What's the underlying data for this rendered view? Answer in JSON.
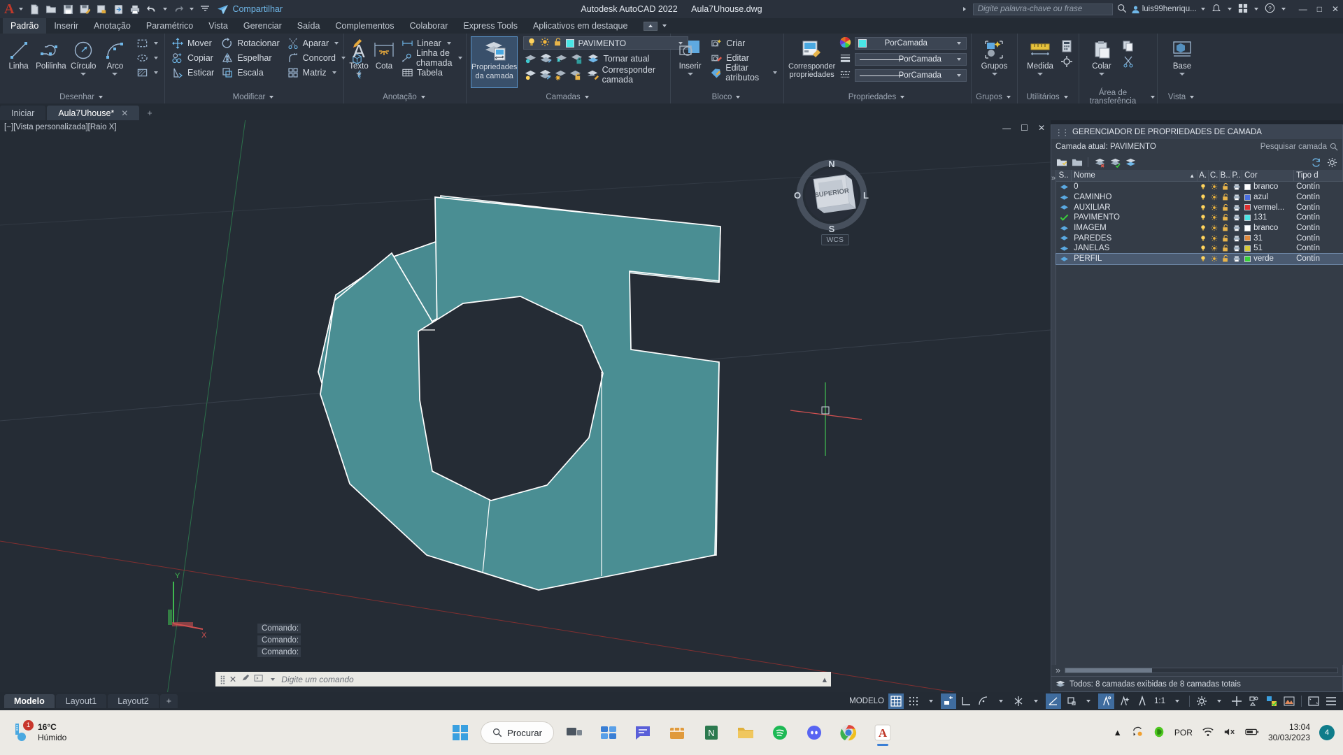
{
  "titlebar": {
    "app_menu": "A",
    "quick_access": [
      "new-icon",
      "open-icon",
      "save-icon",
      "save-as-icon",
      "plot-preview-icon",
      "sync-icon",
      "print-icon",
      "undo-icon",
      "redo-icon",
      "customize-icon"
    ],
    "share_label": "Compartilhar",
    "app_title": "Autodesk AutoCAD 2022",
    "file_name": "Aula7Uhouse.dwg",
    "search_placeholder": "Digite palavra-chave ou frase",
    "user_name": "luis99henriqu...",
    "window_buttons": [
      "minimize",
      "restore",
      "close"
    ]
  },
  "menu": {
    "tabs": [
      "Padrão",
      "Inserir",
      "Anotação",
      "Paramétrico",
      "Vista",
      "Gerenciar",
      "Saída",
      "Complementos",
      "Colaborar",
      "Express Tools",
      "Aplicativos em destaque"
    ],
    "active": "Padrão"
  },
  "ribbon": {
    "panels": [
      {
        "title": "Desenhar",
        "big": [
          {
            "label": "Linha",
            "icon": "line-icon"
          },
          {
            "label": "Polilinha",
            "icon": "polyline-icon"
          },
          {
            "label": "Círculo",
            "icon": "circle-icon",
            "has_dropdown": true
          },
          {
            "label": "Arco",
            "icon": "arc-icon",
            "has_dropdown": true
          }
        ],
        "small_icons": [
          "rectangle-icon",
          "ellipse-icon",
          "hatch-icon"
        ]
      },
      {
        "title": "Modificar",
        "items": [
          {
            "label": "Mover",
            "icon": "move-icon"
          },
          {
            "label": "Rotacionar",
            "icon": "rotate-icon"
          },
          {
            "label": "Aparar",
            "icon": "trim-icon",
            "has_dropdown": true
          },
          {
            "label": "Copiar",
            "icon": "copy-icon"
          },
          {
            "label": "Espelhar",
            "icon": "mirror-icon"
          },
          {
            "label": "Concord",
            "icon": "fillet-icon",
            "has_dropdown": true
          },
          {
            "label": "Esticar",
            "icon": "stretch-icon"
          },
          {
            "label": "Escala",
            "icon": "scale-icon"
          },
          {
            "label": "Matriz",
            "icon": "array-icon",
            "has_dropdown": true
          }
        ],
        "extra_icons": [
          "pencil-icon",
          "3dsolid-icon",
          "offset-icon"
        ]
      },
      {
        "title": "Anotação",
        "big": [
          {
            "label": "Texto",
            "icon": "text-icon",
            "has_dropdown": true
          },
          {
            "label": "Cota",
            "icon": "dimension-icon"
          }
        ],
        "items": [
          {
            "label": "Linear",
            "icon": "linear-dim-icon",
            "has_dropdown": true
          },
          {
            "label": "Linha de chamada",
            "icon": "leader-icon",
            "has_dropdown": true
          },
          {
            "label": "Tabela",
            "icon": "table-icon"
          }
        ]
      },
      {
        "title": "Camadas",
        "big": [
          {
            "label": "Propriedades da camada",
            "icon": "layer-properties-icon",
            "active": true
          }
        ],
        "current_layer": "PAVIMENTO",
        "current_layer_color": "#49e5e5",
        "items": [
          {
            "label": "Tornar atual",
            "icon": "make-current-icon"
          },
          {
            "label": "Corresponder camada",
            "icon": "match-layer-icon"
          }
        ],
        "toggle_icons": [
          "layer-off-icon",
          "layer-isolate-icon",
          "layer-freeze-icon",
          "layer-lock-icon",
          "layer-on-icon",
          "layer-unisolate-icon",
          "layer-thaw-icon",
          "layer-unlock-icon"
        ]
      },
      {
        "title": "Bloco",
        "big": [
          {
            "label": "Inserir",
            "icon": "insert-block-icon",
            "has_dropdown": true
          }
        ],
        "items": [
          {
            "label": "Criar",
            "icon": "create-block-icon"
          },
          {
            "label": "Editar",
            "icon": "edit-block-icon"
          },
          {
            "label": "Editar atributos",
            "icon": "edit-attributes-icon",
            "has_dropdown": true
          }
        ]
      },
      {
        "title": "Propriedades",
        "big": [
          {
            "label": "Corresponder propriedades",
            "icon": "match-properties-icon"
          }
        ],
        "combos": [
          {
            "icon": "color-wheel-icon",
            "value": "PorCamada",
            "swatch": "#49e5e5"
          },
          {
            "icon": "linewidth-icon",
            "value": "PorCamada"
          },
          {
            "icon": "linetype-icon",
            "value": "PorCamada"
          }
        ]
      },
      {
        "title": "Grupos",
        "big": [
          {
            "label": "Grupo",
            "icon": "group-icon",
            "has_dropdown": true
          }
        ]
      },
      {
        "title": "Utilitários",
        "big": [
          {
            "label": "Medida",
            "icon": "measure-icon",
            "has_dropdown": true
          }
        ]
      },
      {
        "title": "Área de transferência",
        "big": [
          {
            "label": "Colar",
            "icon": "paste-icon",
            "has_dropdown": true
          }
        ]
      },
      {
        "title": "Vista",
        "big": [
          {
            "label": "Base",
            "icon": "base-view-icon",
            "has_dropdown": true
          }
        ]
      }
    ]
  },
  "doc_tabs": {
    "tabs": [
      {
        "label": "Iniciar",
        "active": false,
        "closable": false
      },
      {
        "label": "Aula7Uhouse*",
        "active": true,
        "closable": true
      }
    ],
    "add_label": "+"
  },
  "canvas": {
    "viewport_label": "[−][Vista personalizada][Raio X]",
    "viewcube": {
      "top": "SUPERIOR",
      "n": "N",
      "s": "S",
      "o": "O",
      "l": "L"
    },
    "ucs_label": "WCS",
    "command_history": [
      "Comando:",
      "Comando:",
      "Comando:"
    ],
    "command_placeholder": "Digite um comando",
    "shape_fill": "#4a8e93",
    "shape_stroke": "#ffffff"
  },
  "layer_palette": {
    "title": "GERENCIADOR DE PROPRIEDADES DE CAMADA",
    "current_layer_label": "Camada atual: PAVIMENTO",
    "search_placeholder": "Pesquisar camada",
    "toolbar_icons": [
      "new-layer-icon",
      "new-layer-vp-icon",
      "delete-layer-icon",
      "set-current-icon",
      "layer-states-icon",
      "layer-filter-icon"
    ],
    "refresh_icons": [
      "refresh-icon",
      "settings-icon"
    ],
    "columns": [
      "S..",
      "Nome",
      "A.",
      "C.",
      "B..",
      "P..",
      "Cor",
      "Tipo d"
    ],
    "rows": [
      {
        "status": "layer-icon",
        "name": "0",
        "color_name": "branco",
        "color_hex": "#ffffff",
        "linetype": "Contín"
      },
      {
        "status": "layer-icon",
        "name": "CAMINHO",
        "color_name": "azul",
        "color_hex": "#4a6fe0",
        "linetype": "Contín"
      },
      {
        "status": "layer-icon",
        "name": "AUXILIAR",
        "color_name": "vermel...",
        "color_hex": "#e03030",
        "linetype": "Contín"
      },
      {
        "status": "current-layer-icon",
        "name": "PAVIMENTO",
        "color_name": "131",
        "color_hex": "#49e5e5",
        "linetype": "Contín"
      },
      {
        "status": "layer-icon",
        "name": "IMAGEM",
        "color_name": "branco",
        "color_hex": "#ffffff",
        "linetype": "Contín"
      },
      {
        "status": "layer-icon",
        "name": "PAREDES",
        "color_name": "31",
        "color_hex": "#e08a3c",
        "linetype": "Contín"
      },
      {
        "status": "layer-icon",
        "name": "JANELAS",
        "color_name": "51",
        "color_hex": "#d7c93a",
        "linetype": "Contín"
      },
      {
        "status": "layer-icon",
        "name": "PERFIL",
        "color_name": "verde",
        "color_hex": "#3ad13a",
        "linetype": "Contín",
        "selected": true
      }
    ],
    "footer": "Todos: 8 camadas exibidas de 8 camadas totais"
  },
  "model_tabs": {
    "tabs": [
      "Modelo",
      "Layout1",
      "Layout2"
    ],
    "active": "Modelo",
    "add_label": "+"
  },
  "status_bar": {
    "space_label": "MODELO",
    "scale": "1:1",
    "buttons": [
      {
        "name": "grid-display-toggle",
        "on": true
      },
      {
        "name": "snap-mode-toggle",
        "on": false
      },
      {
        "name": "infer-constraints-toggle",
        "on": true
      },
      {
        "name": "ortho-mode-toggle",
        "on": false
      },
      {
        "name": "polar-tracking-toggle",
        "on": false
      },
      {
        "name": "object-snap-toggle",
        "on": true
      },
      {
        "name": "3d-object-snap-toggle",
        "on": false
      },
      {
        "name": "object-snap-tracking-toggle",
        "on": true
      },
      {
        "name": "dynamic-ucs-toggle",
        "on": false
      },
      {
        "name": "dynamic-input-toggle",
        "on": false
      }
    ]
  },
  "taskbar": {
    "weather": {
      "temp": "16°C",
      "condition": "Húmido",
      "badge": "1"
    },
    "search_label": "Procurar",
    "apps": [
      "start-icon",
      "search-pill",
      "task-view-icon",
      "widgets-icon",
      "chat-icon",
      "store-icon",
      "notepad-icon",
      "explorer-icon",
      "spotify-icon",
      "discord-icon",
      "chrome-icon",
      "autocad-icon"
    ],
    "tray": [
      "chevron-up-icon",
      "sync-icon",
      "nvidia-icon"
    ],
    "language": "POR",
    "tray2": [
      "wifi-icon",
      "volume-muted-icon",
      "battery-icon"
    ],
    "time": "13:04",
    "date": "30/03/2023",
    "notification_count": "4"
  }
}
